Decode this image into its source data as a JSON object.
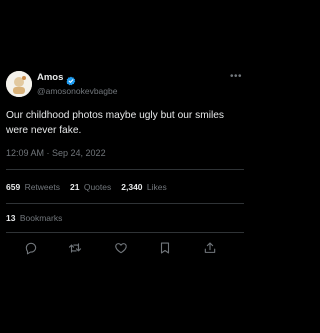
{
  "tweet": {
    "author": {
      "display_name": "Amos",
      "handle": "@amosonokevbagbe",
      "verified": true,
      "avatar_icon": "avatar-image"
    },
    "more_label": "•••",
    "text": "Our childhood photos maybe ugly but our smiles were never fake.",
    "timestamp": "12:09 AM · Sep 24, 2022",
    "stats": {
      "retweets_count": "659",
      "retweets_label": "Retweets",
      "quotes_count": "21",
      "quotes_label": "Quotes",
      "likes_count": "2,340",
      "likes_label": "Likes",
      "bookmarks_count": "13",
      "bookmarks_label": "Bookmarks"
    },
    "actions": [
      "reply-icon",
      "retweet-icon",
      "like-icon",
      "bookmark-icon",
      "share-icon"
    ]
  },
  "colors": {
    "background": "#000000",
    "text_primary": "#e7e9ea",
    "text_secondary": "#71767b",
    "divider": "#2f3336",
    "verified_badge": "#1d9bf0"
  }
}
